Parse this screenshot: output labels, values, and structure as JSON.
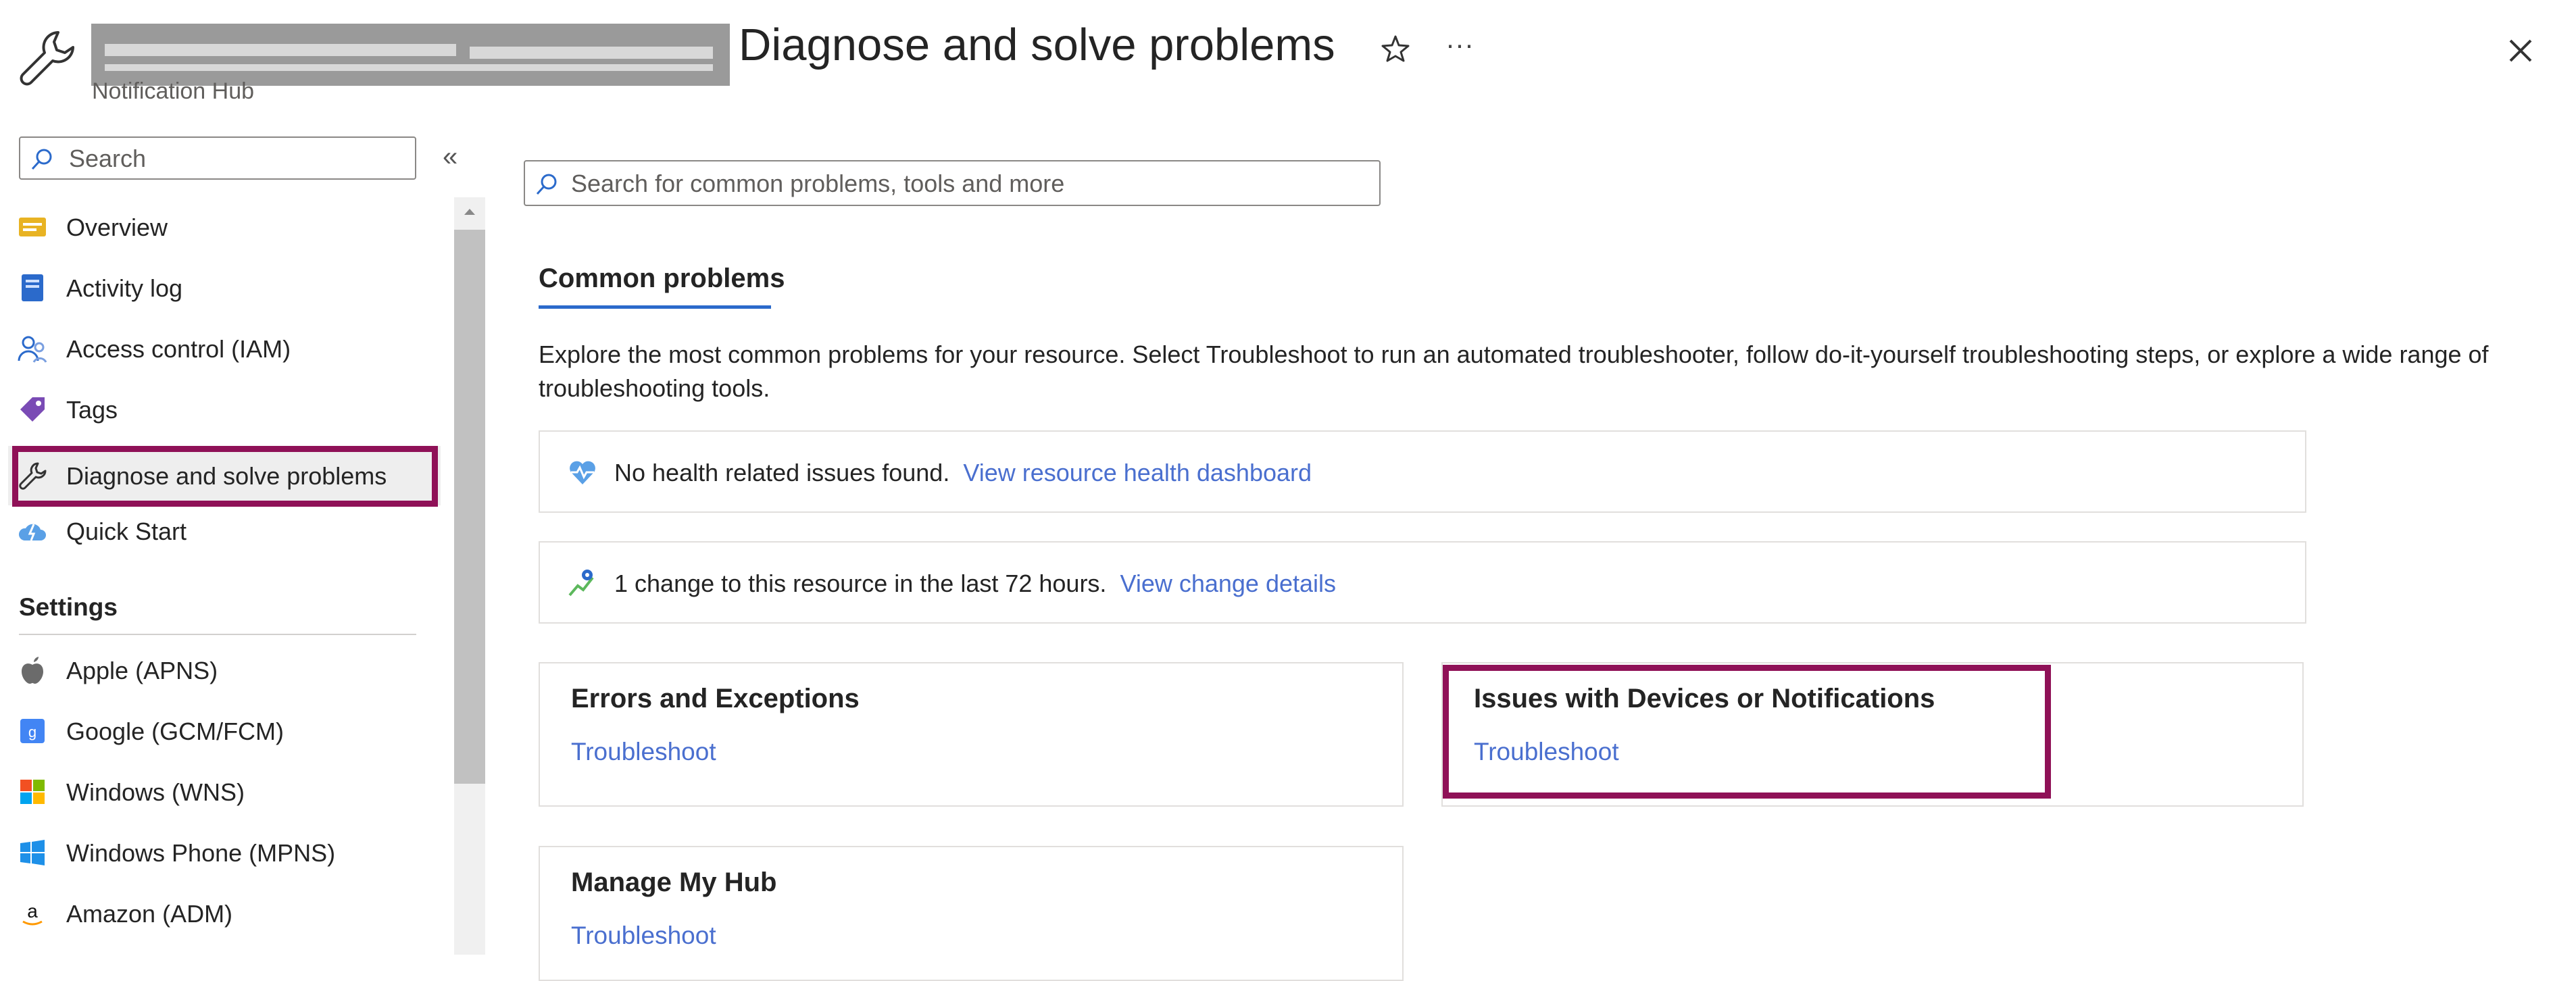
{
  "header": {
    "title": "Diagnose and solve problems",
    "subtitle": "Notification Hub",
    "more_label": "···"
  },
  "sidebar": {
    "search_placeholder": "Search",
    "collapse_label": "«",
    "items": [
      {
        "label": "Overview",
        "icon": "overview-icon"
      },
      {
        "label": "Activity log",
        "icon": "activity-log-icon"
      },
      {
        "label": "Access control (IAM)",
        "icon": "access-control-icon"
      },
      {
        "label": "Tags",
        "icon": "tag-icon"
      },
      {
        "label": "Diagnose and solve problems",
        "icon": "wrench-icon"
      },
      {
        "label": "Quick Start",
        "icon": "cloud-icon"
      }
    ],
    "settings_heading": "Settings",
    "settings_items": [
      {
        "label": "Apple (APNS)",
        "icon": "apple-icon"
      },
      {
        "label": "Google (GCM/FCM)",
        "icon": "google-icon"
      },
      {
        "label": "Windows (WNS)",
        "icon": "windows-icon"
      },
      {
        "label": "Windows Phone (MPNS)",
        "icon": "windows-phone-icon"
      },
      {
        "label": "Amazon (ADM)",
        "icon": "amazon-icon"
      }
    ]
  },
  "main": {
    "search_placeholder": "Search for common problems, tools and more",
    "tab": "Common problems",
    "description": "Explore the most common problems for your resource. Select Troubleshoot to run an automated troubleshooter, follow do-it-yourself troubleshooting steps, or explore a wide range of troubleshooting tools.",
    "health_banner": {
      "text": "No health related issues found.",
      "link": "View resource health dashboard"
    },
    "change_banner": {
      "text": "1 change to this resource in the last 72 hours.",
      "link": "View change details"
    },
    "cards": [
      {
        "title": "Errors and Exceptions",
        "link": "Troubleshoot"
      },
      {
        "title": "Issues with Devices or Notifications",
        "link": "Troubleshoot"
      },
      {
        "title": "Manage My Hub",
        "link": "Troubleshoot"
      }
    ]
  },
  "colors": {
    "highlight": "#8f1157",
    "link": "#4a6fcf",
    "tab_underline": "#2b6acb"
  }
}
